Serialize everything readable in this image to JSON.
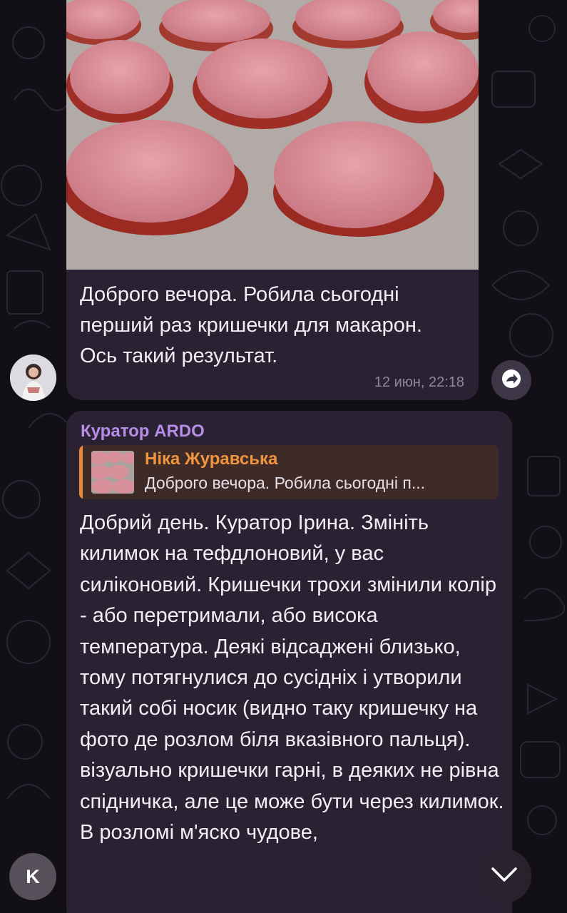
{
  "chat": {
    "incoming": {
      "text": "Доброго вечора. Робила сьогодні перший раз кришечки для макарон. Ось такий результат.",
      "time": "12 июн, 22:18",
      "photo_icon": "macaron-shells-photo",
      "avatar_icon": "user-avatar-photo"
    },
    "share_icon": "forward-arrow-icon",
    "reply": {
      "sender": "Куратор ARDO",
      "quote": {
        "name": "Ніка Журавська",
        "snippet": "Доброго вечора. Робила сьогодні п..."
      },
      "text": "Добрий день. Куратор Ірина. Змініть килимок на тефдлоновий, у вас силіконовий. Кришечки трохи змінили колір - або перетримали, або висока температура. Деякі відсаджені близько, тому потягнулися до сусідніх і утворили такий собі носик (видно таку кришечку на фото де розлом біля вказівного пальця). візуально кришечки гарні, в деяких не рівна спідничка, але це може бути через килимок. В розломі м'яско чудове,"
    }
  },
  "controls": {
    "k_label": "K",
    "scroll_down_icon": "chevron-down-icon"
  },
  "colors": {
    "background": "#121016",
    "bubble": "#2a2233",
    "sender_name": "#b78be8",
    "quote_accent": "#e8893b",
    "quote_name": "#f0943f",
    "timestamp": "#8f8699"
  }
}
